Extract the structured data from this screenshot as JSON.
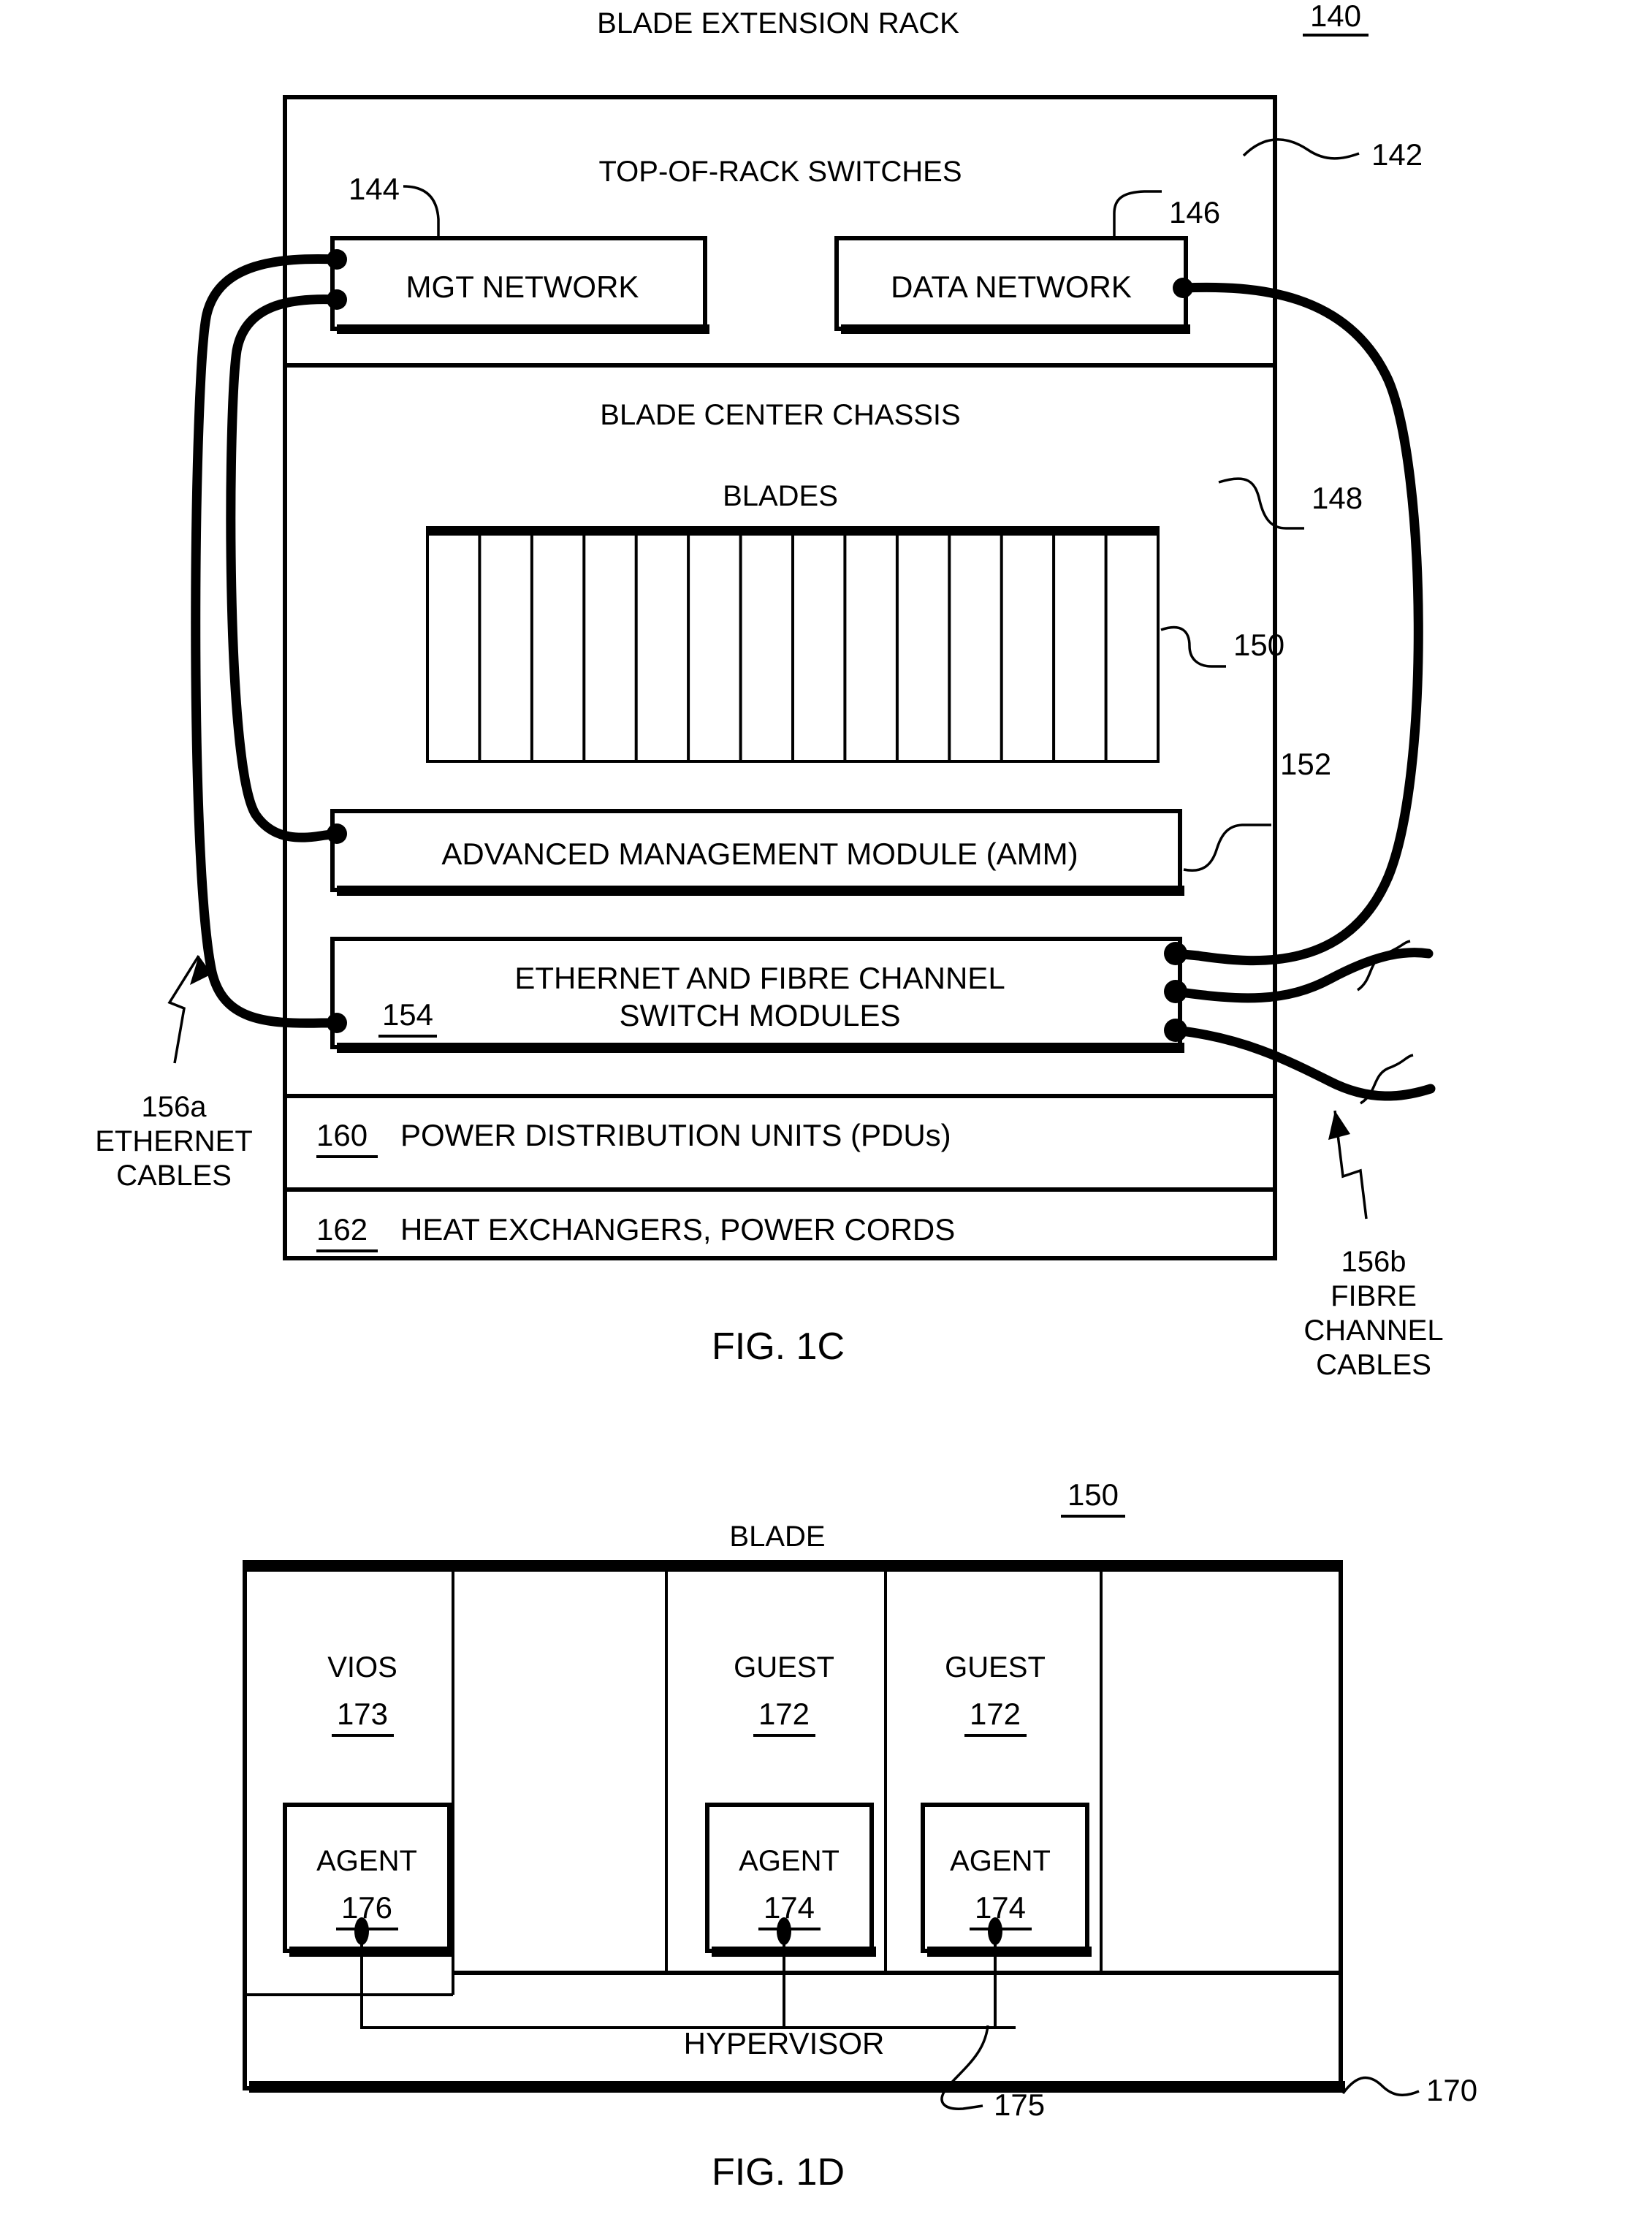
{
  "figures": [
    {
      "id": "fig-1c",
      "caption": "FIG. 1C",
      "title": "BLADE EXTENSION RACK",
      "ref": "140",
      "rack_ref": "142",
      "sections": {
        "top_of_rack": {
          "label": "TOP-OF-RACK SWITCHES",
          "boxes": [
            {
              "label": "MGT NETWORK",
              "ref": "144",
              "ports": 2
            },
            {
              "label": "DATA NETWORK",
              "ref": "146",
              "ports": 1
            }
          ]
        },
        "chassis": {
          "label": "BLADE CENTER CHASSIS",
          "ref": "148",
          "blades_label": "BLADES",
          "blades_ref": "150",
          "blade_count": 14,
          "amm": {
            "label": "ADVANCED MANAGEMENT MODULE (AMM)",
            "ref": "152"
          },
          "switch_modules": {
            "line1": "ETHERNET AND FIBRE CHANNEL",
            "line2": "SWITCH MODULES",
            "ref": "154",
            "ports": 3
          }
        },
        "pdu": {
          "ref": "160",
          "label": "POWER DISTRIBUTION UNITS (PDUs)"
        },
        "heat": {
          "ref": "162",
          "label": "HEAT EXCHANGERS, POWER CORDS"
        }
      },
      "callouts": [
        {
          "ref": "156a",
          "line1": "ETHERNET",
          "line2": "CABLES"
        },
        {
          "ref": "156b",
          "line1": "FIBRE",
          "line2": "CHANNEL",
          "line3": "CABLES"
        }
      ]
    },
    {
      "id": "fig-1d",
      "caption": "FIG. 1D",
      "title": "BLADE",
      "ref": "150",
      "blade_ref": "170",
      "partitions": [
        {
          "name": "VIOS",
          "ref": "173",
          "agent": {
            "label": "AGENT",
            "ref": "176"
          }
        },
        {
          "name": "",
          "ref": "",
          "agent": null
        },
        {
          "name": "GUEST",
          "ref": "172",
          "agent": {
            "label": "AGENT",
            "ref": "174"
          }
        },
        {
          "name": "GUEST",
          "ref": "172",
          "agent": {
            "label": "AGENT",
            "ref": "174"
          }
        },
        {
          "name": "",
          "ref": "",
          "agent": null
        }
      ],
      "hypervisor": {
        "label": "HYPERVISOR",
        "ref": "175"
      }
    }
  ]
}
